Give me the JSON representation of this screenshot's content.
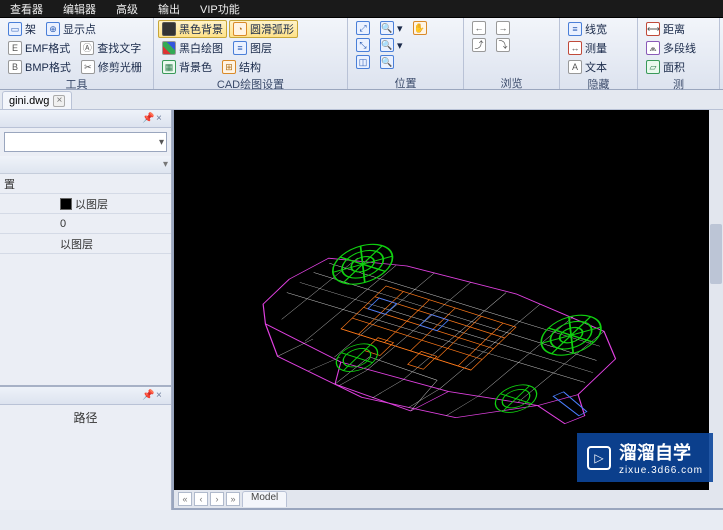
{
  "menubar": {
    "items": [
      "查看器",
      "编辑器",
      "高级",
      "输出",
      "VIP功能"
    ]
  },
  "ribbon": {
    "group_tools": {
      "label": "工具",
      "items": [
        "架",
        "显示点",
        "EMF格式",
        "查找文字",
        "BMP格式",
        "修剪光栅"
      ]
    },
    "group_cad": {
      "label": "CAD绘图设置",
      "items": [
        "黑色背景",
        "圆滑弧形",
        "黑白绘图",
        "图层",
        "背景色",
        "结构"
      ],
      "selected": [
        0,
        1
      ]
    },
    "group_pos": {
      "label": "位置"
    },
    "group_view": {
      "label": "浏览"
    },
    "group_hide": {
      "label": "隐藏",
      "items": [
        "线宽",
        "测量",
        "文本"
      ]
    },
    "group_meas": {
      "label": "测",
      "items": [
        "距离",
        "多段线",
        "面积"
      ]
    }
  },
  "filetab": {
    "name": "gini.dwg"
  },
  "propspanel": {
    "rows": [
      {
        "k": "置",
        "v": ""
      },
      {
        "k": "",
        "v": "以图层",
        "swatch": true
      },
      {
        "k": "",
        "v": "0"
      },
      {
        "k": "",
        "v": "以图层"
      }
    ]
  },
  "pathpanel": {
    "label": "路径"
  },
  "modeltabs": {
    "tabs": [
      "Model"
    ]
  },
  "watermark": {
    "brand": "溜溜自学",
    "url": "zixue.3d66.com"
  }
}
